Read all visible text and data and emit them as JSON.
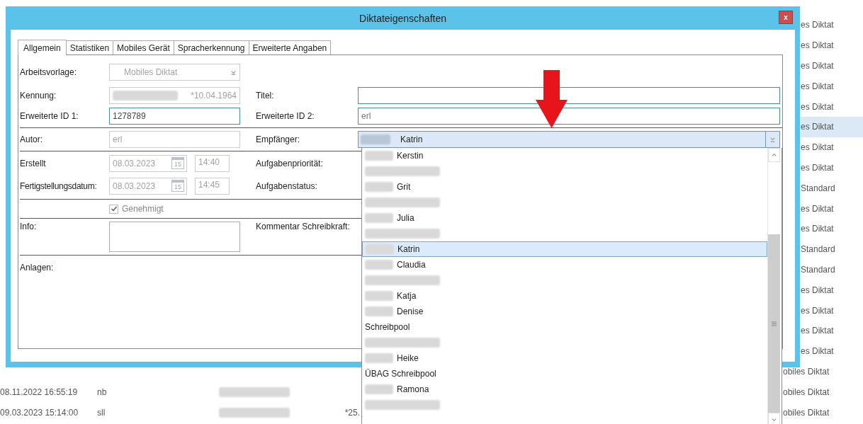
{
  "background_table": {
    "rows": [
      {
        "type": "es Diktat",
        "selected": false
      },
      {
        "type": "es Diktat",
        "selected": false
      },
      {
        "type": "es Diktat",
        "selected": false
      },
      {
        "type": "es Diktat",
        "selected": false
      },
      {
        "type": "es Diktat",
        "selected": false
      },
      {
        "type": "es Diktat",
        "selected": true
      },
      {
        "type": "es Diktat",
        "selected": false
      },
      {
        "type": "es Diktat",
        "selected": false
      },
      {
        "type": "Standard",
        "selected": false
      },
      {
        "type": "es Diktat",
        "selected": false
      },
      {
        "type": "es Diktat",
        "selected": false
      },
      {
        "type": "Standard",
        "selected": false
      },
      {
        "type": "Standard",
        "selected": false
      },
      {
        "type": "es Diktat",
        "selected": false
      },
      {
        "type": "es Diktat",
        "selected": false
      },
      {
        "type": "es Diktat",
        "selected": false
      },
      {
        "type": "es Diktat",
        "selected": false
      },
      {
        "type": "obiles Diktat",
        "selected": false
      },
      {
        "date": "08.11.2022 16:55:19",
        "user": "nb",
        "type": "obiles Diktat",
        "selected": false
      },
      {
        "date": "09.03.2023 15:14:00",
        "user": "sll",
        "value": "*25.",
        "type": "obiles Diktat",
        "selected": false
      }
    ]
  },
  "dialog": {
    "title": "Diktateigenschaften",
    "close": "x",
    "tabs": [
      {
        "label": "Allgemein",
        "selected": true
      },
      {
        "label": "Statistiken",
        "selected": false
      },
      {
        "label": "Mobiles Gerät",
        "selected": false
      },
      {
        "label": "Spracherkennung",
        "selected": false
      },
      {
        "label": "Erweiterte Angaben",
        "selected": false
      }
    ],
    "form": {
      "arbeitsvorlage": {
        "label": "Arbeitsvorlage:",
        "value": "Mobiles Diktat",
        "disabled": true
      },
      "kennung": {
        "label": "Kennung:",
        "value": "*10.04.1964",
        "disabled": true
      },
      "titel": {
        "label": "Titel:"
      },
      "erweiterte_id_1": {
        "label": "Erweiterte ID 1:",
        "value": "1278789",
        "disabled": false
      },
      "erweiterte_id_2": {
        "label": "Erweiterte ID 2:",
        "value": "erl",
        "disabled": false
      },
      "autor": {
        "label": "Autor:",
        "value": "erl",
        "disabled": true
      },
      "empfaenger": {
        "label": "Empfänger:",
        "value": "Katrin",
        "expanded": true
      },
      "erstellt": {
        "label": "Erstellt",
        "date": "08.03.2023",
        "calendar": "15",
        "time": "14:40",
        "disabled": true
      },
      "aufgabenprioritaet": {
        "label": "Aufgabenpriorität:"
      },
      "fertigstellungsdatum": {
        "label": "Fertigstellungsdatum:",
        "date": "08.03.2023",
        "calendar": "15",
        "time": "14:45",
        "disabled": true
      },
      "aufgabenstatus": {
        "label": "Aufgabenstatus:"
      },
      "genehmigt": {
        "label": "Genehmigt",
        "checked": true,
        "disabled": true
      },
      "info": {
        "label": "Info:"
      },
      "kommentar_schreibkraft": {
        "label": "Kommentar Schreibkraft:"
      },
      "anlagen": {
        "label": "Anlagen:"
      }
    }
  },
  "dropdown_list": {
    "items": [
      {
        "kind": "person",
        "name": "Kerstin",
        "selected": false
      },
      {
        "kind": "redacted",
        "selected": false
      },
      {
        "kind": "person",
        "name": "Grit",
        "selected": false
      },
      {
        "kind": "redacted",
        "selected": false
      },
      {
        "kind": "person",
        "name": "Julia",
        "selected": false
      },
      {
        "kind": "redacted",
        "selected": false
      },
      {
        "kind": "person",
        "name": "Katrin",
        "selected": true
      },
      {
        "kind": "person",
        "name": "Claudia",
        "selected": false
      },
      {
        "kind": "redacted",
        "selected": false
      },
      {
        "kind": "person",
        "name": "Katja",
        "selected": false
      },
      {
        "kind": "person",
        "name": "Denise",
        "selected": false
      },
      {
        "kind": "group",
        "name": "Schreibpool",
        "selected": false
      },
      {
        "kind": "redacted",
        "selected": false
      },
      {
        "kind": "person",
        "name": "Heike",
        "selected": false
      },
      {
        "kind": "group",
        "name": "ÜBAG Schreibpool",
        "selected": false
      },
      {
        "kind": "person",
        "name": "Ramona",
        "selected": false
      },
      {
        "kind": "redacted",
        "selected": false
      }
    ]
  }
}
